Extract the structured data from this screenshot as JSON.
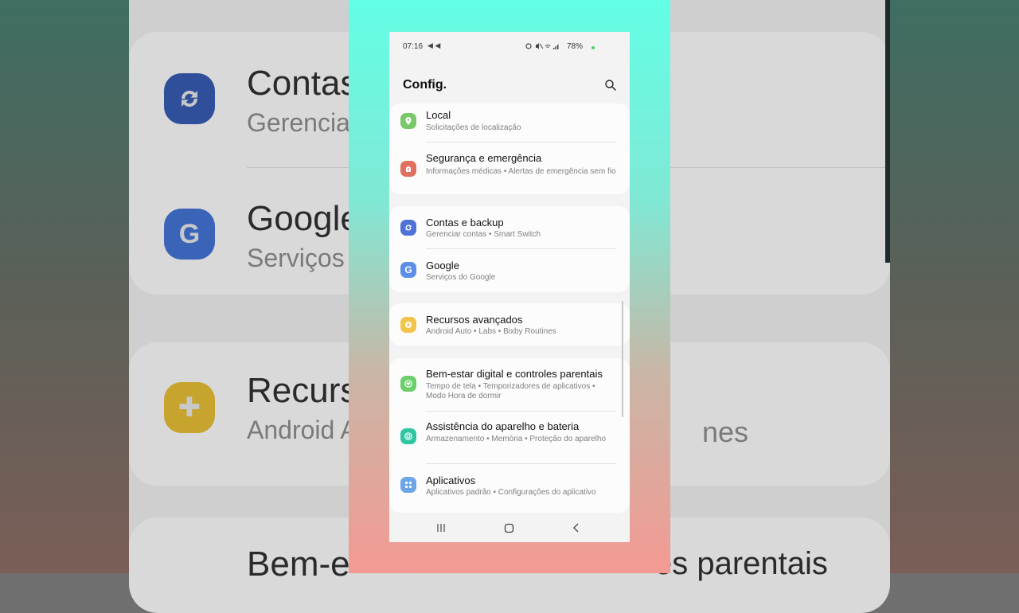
{
  "status": {
    "time": "07:16",
    "nav_icons": "◀ ◀",
    "icons": "⏰ 🔇 ≋ .ıl",
    "battery": "78%"
  },
  "header": {
    "title": "Config."
  },
  "colors": {
    "green": "#7bc86c",
    "red": "#e0715f",
    "blue": "#4f72d8",
    "google_blue": "#5d8ee6",
    "yellow": "#f3c44b",
    "teal": "#2fc6a1",
    "light_blue": "#6aa6e8",
    "digital_green": "#6ccf6c"
  },
  "items": [
    {
      "id": "local",
      "title": "Local",
      "subtitle": "Solicitações de localização",
      "icon": "location-pin-icon"
    },
    {
      "id": "security",
      "title": "Segurança e emergência",
      "subtitle": "Informações médicas  •  Alertas de emergência sem fio",
      "icon": "emergency-icon"
    },
    {
      "id": "accounts",
      "title": "Contas e backup",
      "subtitle": "Gerenciar contas  •  Smart Switch",
      "icon": "sync-icon"
    },
    {
      "id": "google",
      "title": "Google",
      "subtitle": "Serviços do Google",
      "icon": "google-icon"
    },
    {
      "id": "advanced",
      "title": "Recursos avançados",
      "subtitle": "Android Auto  •  Labs  •  Bixby Routines",
      "icon": "plus-gear-icon"
    },
    {
      "id": "wellbeing",
      "title": "Bem-estar digital e controles parentais",
      "subtitle": "Tempo de tela  •  Temporizadores de aplicativos  •  Modo Hora de dormir",
      "icon": "heart-icon"
    },
    {
      "id": "care",
      "title": "Assistência do aparelho e bateria",
      "subtitle": "Armazenamento  •  Memória  •  Proteção do aparelho",
      "icon": "device-care-icon"
    },
    {
      "id": "apps",
      "title": "Aplicativos",
      "subtitle": "Aplicativos padrão  •  Configurações do aplicativo",
      "icon": "apps-grid-icon"
    }
  ],
  "background": {
    "title1": "Contas",
    "sub1": "Gerencia",
    "title2": "Google",
    "sub2": "Serviços",
    "title3": "Recurs",
    "sub3": "Android A",
    "right3": "nes",
    "title4": "Bem-e",
    "right4": "es parentais",
    "icon2_letter": "G"
  }
}
